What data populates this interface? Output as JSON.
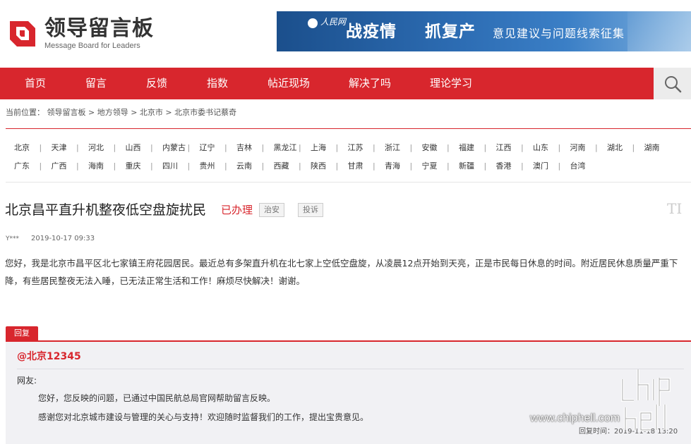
{
  "header": {
    "logo_title": "领导留言板",
    "logo_subtitle": "Message Board for Leaders",
    "banner": {
      "source": "人民网",
      "headline_1": "战疫情",
      "headline_2": "抓复产",
      "subline": "意见建议与问题线索征集"
    }
  },
  "nav": {
    "items": [
      "首页",
      "留言",
      "反馈",
      "指数",
      "帖近现场",
      "解决了吗",
      "理论学习"
    ],
    "search_icon": "search-icon",
    "color": "#d8262d"
  },
  "breadcrumb": {
    "text": "当前位置： 领导留言板 > 地方领导 > 北京市 > 北京市委书记蔡奇"
  },
  "regions": {
    "row1": [
      "北京",
      "天津",
      "河北",
      "山西",
      "内蒙古",
      "辽宁",
      "吉林",
      "黑龙江",
      "上海",
      "江苏",
      "浙江",
      "安徽",
      "福建",
      "江西",
      "山东",
      "河南",
      "湖北",
      "湖南"
    ],
    "row2": [
      "广东",
      "广西",
      "海南",
      "重庆",
      "四川",
      "贵州",
      "云南",
      "西藏",
      "陕西",
      "甘肃",
      "青海",
      "宁夏",
      "新疆",
      "香港",
      "澳门",
      "台湾"
    ]
  },
  "post": {
    "title": "北京昌平直升机整夜低空盘旋扰民",
    "status": "已办理",
    "tags": [
      "治安",
      "投诉"
    ],
    "font_size_icon": "TI",
    "user": "Y***",
    "date": "2019-10-17 09:33",
    "body": "您好，我是北京市昌平区北七家镇王府花园居民。最近总有多架直升机在北七家上空低空盘旋，从凌晨12点开始到天亮，正是市民每日休息的时间。附近居民休息质量严重下降，有些居民整夜无法入睡，已无法正常生活和工作！麻烦尽快解决！谢谢。"
  },
  "reply": {
    "label": "回复",
    "org": "@北京12345",
    "greeting": "网友:",
    "paragraph_1": "您好，您反映的问题，已通过中国民航总局官网帮助留言反映。",
    "paragraph_2": "感谢您对北京城市建设与管理的关心与支持！欢迎随时监督我们的工作，提出宝贵意见。",
    "time": "回复时间：2019-11-18 13:20"
  },
  "watermark": {
    "text": "www.chiphell.com"
  },
  "colors": {
    "brand_red": "#d8262d",
    "banner_blue": "#2d6db4"
  }
}
